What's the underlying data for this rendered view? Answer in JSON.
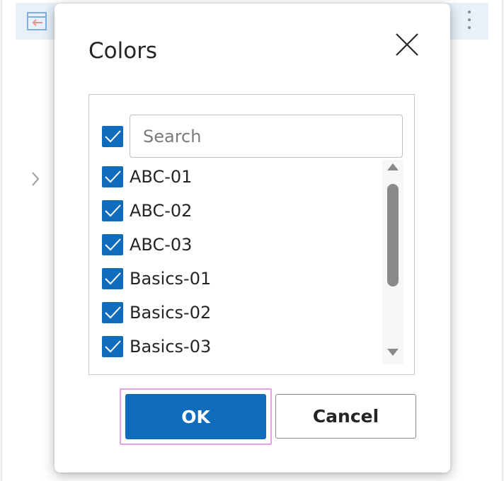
{
  "dialog": {
    "title": "Colors",
    "close_icon": "close-icon",
    "select_all_checked": true,
    "search": {
      "placeholder": "Search",
      "value": ""
    },
    "items": [
      {
        "label": "ABC-01",
        "checked": true
      },
      {
        "label": "ABC-02",
        "checked": true
      },
      {
        "label": "ABC-03",
        "checked": true
      },
      {
        "label": "Basics-01",
        "checked": true
      },
      {
        "label": "Basics-02",
        "checked": true
      },
      {
        "label": "Basics-03",
        "checked": true
      }
    ],
    "ok_label": "OK",
    "cancel_label": "Cancel"
  },
  "background": {
    "back_icon": "panel-back-icon",
    "more_icon": "more-vertical-icon",
    "chevron_icon": "chevron-right-icon"
  },
  "colors": {
    "accent": "#0f6cbd",
    "focus_ring": "#e8a0ea",
    "header_bg": "#e8f0fa"
  }
}
